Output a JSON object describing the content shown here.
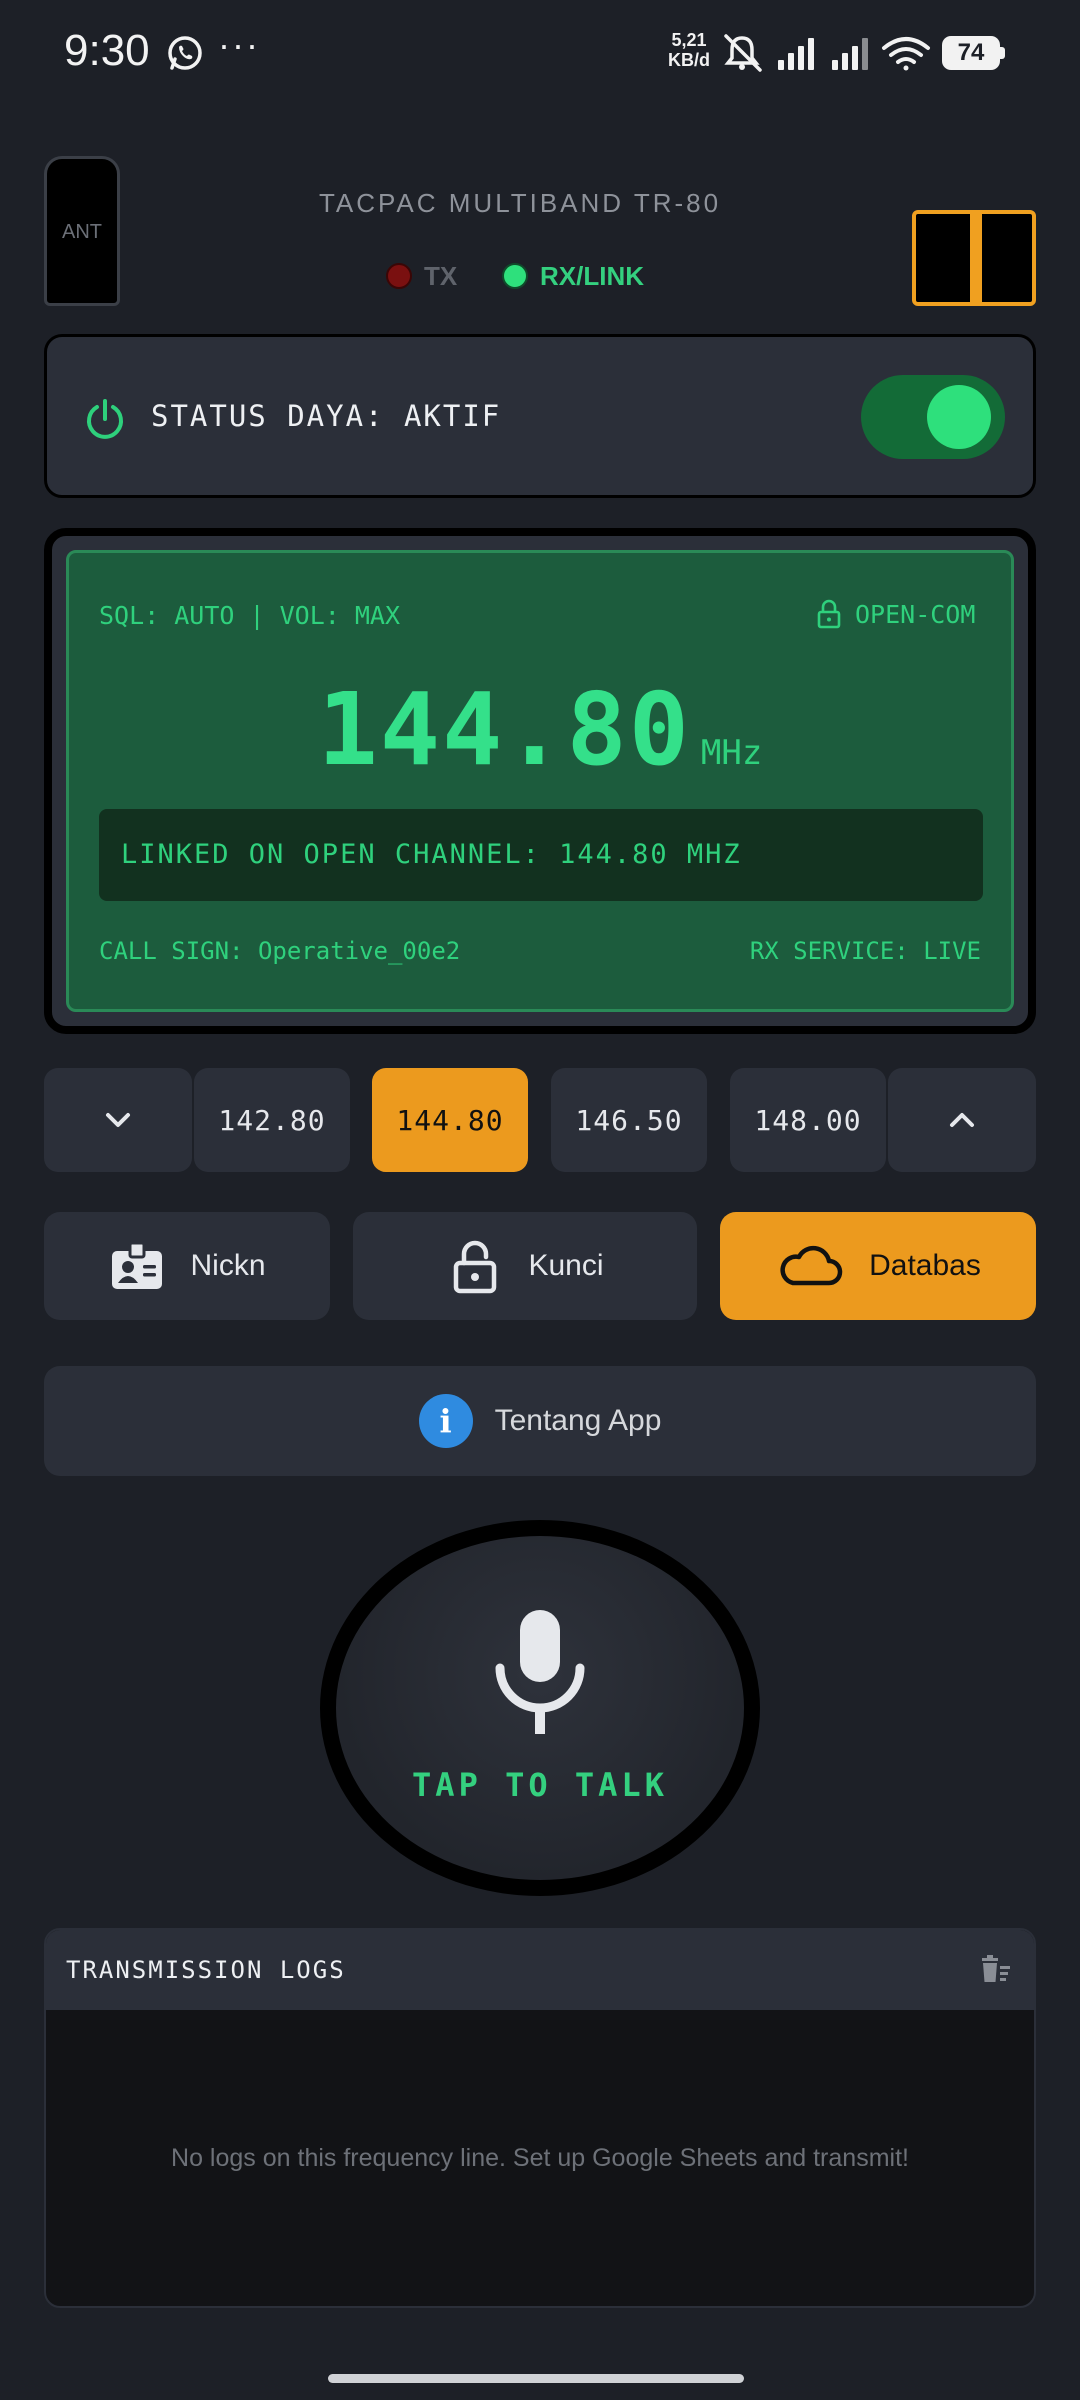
{
  "status_bar": {
    "time": "9:30",
    "more": "···",
    "net_speed_value": "5,21",
    "net_speed_unit": "KB/d",
    "battery_level": "74",
    "icons": [
      "whatsapp-icon",
      "bell-muted-icon",
      "signal-icon",
      "signal-icon",
      "wifi-icon",
      "battery-icon"
    ]
  },
  "header": {
    "antenna_label": "ANT",
    "model": "TACPAC MULTIBAND TR-80",
    "tx_label": "TX",
    "rx_label": "RX/LINK",
    "tx_active": false,
    "rx_active": true
  },
  "power": {
    "label": "STATUS DAYA: AKTIF",
    "on": true
  },
  "display": {
    "sql_vol": "SQL: AUTO | VOL: MAX",
    "lock_status": "OPEN-COM",
    "frequency": "144.80",
    "unit": "MHz",
    "link_message": "LINKED ON OPEN CHANNEL: 144.80 MHZ",
    "call_sign": "CALL SIGN: Operative_00e2",
    "rx_service": "RX SERVICE: LIVE"
  },
  "channels": {
    "presets": [
      "142.80",
      "144.80",
      "146.50",
      "148.00"
    ],
    "active": "144.80"
  },
  "actions": {
    "nickname": "Nickn",
    "lock": "Kunci",
    "database": "Databas",
    "about": "Tentang App"
  },
  "ptt": {
    "label": "TAP TO TALK"
  },
  "logs": {
    "title": "TRANSMISSION LOGS",
    "empty_message": "No logs on this frequency line. Set up Google Sheets and transmit!"
  },
  "colors": {
    "background": "#1d2027",
    "card": "#2b2f39",
    "accent": "#ec9a1e",
    "screen_green": "#1c5c3d",
    "text_green": "#34d07f"
  }
}
